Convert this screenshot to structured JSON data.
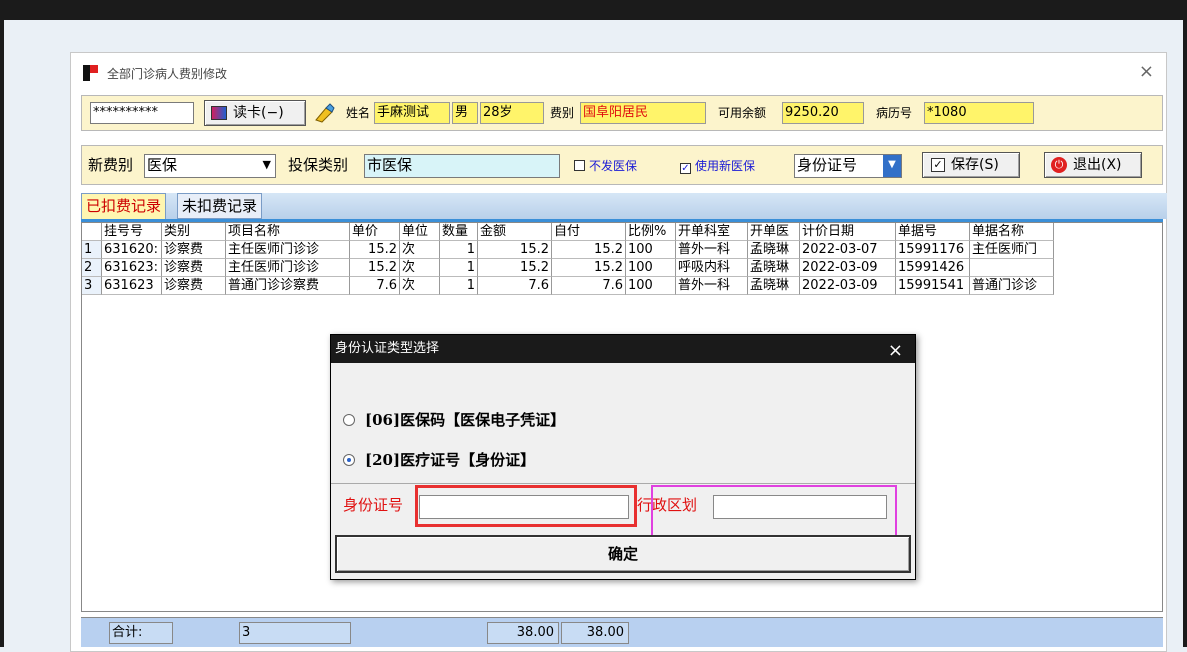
{
  "window": {
    "title": "全部门诊病人费别修改",
    "close": "×"
  },
  "row1": {
    "card_no": "**********",
    "read_card": "读卡(−)",
    "name_label": "姓名",
    "name": "手麻测试",
    "sex": "男",
    "age": "28岁",
    "fee_label": "费别",
    "fee": "国阜阳居民",
    "balance_label": "可用余额",
    "balance": "9250.20",
    "record_label": "病历号",
    "record": "*1080"
  },
  "row2": {
    "new_fee_label": "新费别",
    "new_fee": "医保",
    "insure_label": "投保类别",
    "insure": "市医保",
    "no_insurance": "不发医保",
    "use_new_insurance": "使用新医保",
    "id_type": "身份证号",
    "save": "保存(S)",
    "exit": "退出(X)"
  },
  "tabs": [
    "已扣费记录",
    "未扣费记录"
  ],
  "table": {
    "columns": [
      "",
      "挂号号",
      "类别",
      "项目名称",
      "单价",
      "单位",
      "数量",
      "金额",
      "自付",
      "比例%",
      "开单科室",
      "开单医",
      "计价日期",
      "单据号",
      "单据名称"
    ],
    "rows": [
      [
        "1",
        "631620:",
        "诊察费",
        "主任医师门诊诊",
        "15.2",
        "次",
        "1",
        "15.2",
        "15.2",
        "100",
        "普外一科",
        "孟晓琳",
        "2022-03-07",
        "15991176",
        "主任医师门"
      ],
      [
        "2",
        "631623:",
        "诊察费",
        "主任医师门诊诊",
        "15.2",
        "次",
        "1",
        "15.2",
        "15.2",
        "100",
        "呼吸内科",
        "孟晓琳",
        "2022-03-09",
        "15991426",
        ""
      ],
      [
        "3",
        "631623",
        "诊察费",
        "普通门诊诊察费",
        "7.6",
        "次",
        "1",
        "7.6",
        "7.6",
        "100",
        "普外一科",
        "孟晓琳",
        "2022-03-09",
        "15991541",
        "普通门诊诊"
      ]
    ]
  },
  "footer": {
    "total_label": "合计:",
    "count": "3",
    "amount": "38.00",
    "self_pay": "38.00"
  },
  "dialog": {
    "title": "身份认证类型选择",
    "close": "×",
    "options": [
      "[06]医保码【医保电子凭证】",
      "[20]医疗证号【身份证】"
    ],
    "selected": 1,
    "id_label": "身份证号",
    "id_value": "",
    "region_label": "行政区划",
    "region_value": "",
    "confirm": "确定"
  }
}
